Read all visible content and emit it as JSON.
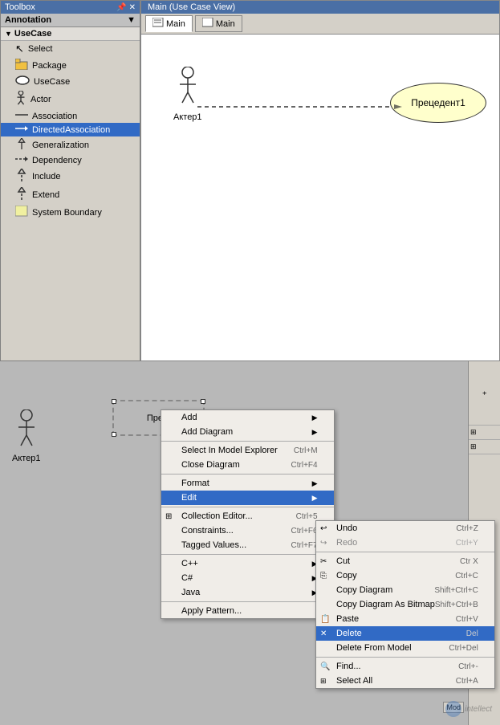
{
  "toolbox": {
    "title": "Toolbox",
    "annotation_label": "Annotation",
    "group_label": "UseCase",
    "items": [
      {
        "label": "Select",
        "icon": "select"
      },
      {
        "label": "Package",
        "icon": "package"
      },
      {
        "label": "UseCase",
        "icon": "usecase"
      },
      {
        "label": "Actor",
        "icon": "actor"
      },
      {
        "label": "Association",
        "icon": "association"
      },
      {
        "label": "DirectedAssociation",
        "icon": "directed-association"
      },
      {
        "label": "Generalization",
        "icon": "generalization"
      },
      {
        "label": "Dependency",
        "icon": "dependency"
      },
      {
        "label": "Include",
        "icon": "include"
      },
      {
        "label": "Extend",
        "icon": "extend"
      },
      {
        "label": "System Boundary",
        "icon": "boundary"
      }
    ]
  },
  "main_window": {
    "title": "Main (Use Case View)",
    "tabs": [
      {
        "label": "Main",
        "icon": "diagram"
      },
      {
        "label": "Main",
        "icon": "diagram"
      }
    ]
  },
  "diagram": {
    "actor1_label": "Актер1",
    "usecase1_label": "Прецедент1"
  },
  "bottom_diagram": {
    "actor_label": "Актер1",
    "usecase_label": "Пре..."
  },
  "context_menu_main": {
    "items": [
      {
        "label": "Add",
        "shortcut": "",
        "has_submenu": true,
        "disabled": false
      },
      {
        "label": "Add Diagram",
        "shortcut": "",
        "has_submenu": true,
        "disabled": false
      },
      {
        "label": "Select In Model Explorer",
        "shortcut": "Ctrl+M",
        "has_submenu": false,
        "disabled": false
      },
      {
        "label": "Close Diagram",
        "shortcut": "Ctrl+F4",
        "has_submenu": false,
        "disabled": false
      },
      {
        "label": "Format",
        "shortcut": "",
        "has_submenu": true,
        "disabled": false
      },
      {
        "label": "Edit",
        "shortcut": "",
        "has_submenu": true,
        "disabled": false,
        "highlighted": true
      },
      {
        "label": "Collection Editor...",
        "shortcut": "Ctrl+5",
        "has_submenu": false,
        "disabled": false
      },
      {
        "label": "Constraints...",
        "shortcut": "Ctrl+F6",
        "has_submenu": false,
        "disabled": false
      },
      {
        "label": "Tagged Values...",
        "shortcut": "Ctrl+F7",
        "has_submenu": false,
        "disabled": false
      },
      {
        "label": "C++",
        "shortcut": "",
        "has_submenu": true,
        "disabled": false
      },
      {
        "label": "C#",
        "shortcut": "",
        "has_submenu": true,
        "disabled": false
      },
      {
        "label": "Java",
        "shortcut": "",
        "has_submenu": true,
        "disabled": false
      },
      {
        "label": "Apply Pattern...",
        "shortcut": "",
        "has_submenu": false,
        "disabled": false
      }
    ]
  },
  "submenu_edit": {
    "items": [
      {
        "label": "Undo",
        "shortcut": "Ctrl+Z",
        "disabled": false
      },
      {
        "label": "Redo",
        "shortcut": "Ctrl+Y",
        "disabled": true
      },
      {
        "label": "Cut",
        "shortcut": "Ctrl  X",
        "disabled": false
      },
      {
        "label": "Copy",
        "shortcut": "Ctrl+C",
        "disabled": false
      },
      {
        "label": "Copy Diagram",
        "shortcut": "Shift+Ctrl+C",
        "disabled": false
      },
      {
        "label": "Copy Diagram As Bitmap",
        "shortcut": "Shift+Ctrl+B",
        "disabled": false
      },
      {
        "label": "Paste",
        "shortcut": "Ctrl+V",
        "disabled": false
      },
      {
        "label": "Delete",
        "shortcut": "Del",
        "disabled": false,
        "highlighted": true
      },
      {
        "label": "Delete From Model",
        "shortcut": "Ctrl+Del",
        "disabled": false
      },
      {
        "label": "Find...",
        "shortcut": "Ctrl+-",
        "disabled": false
      },
      {
        "label": "Select All",
        "shortcut": "Ctrl+A",
        "disabled": false
      }
    ]
  },
  "mod_label": "Mod",
  "watermark": {
    "text": "intellect"
  }
}
